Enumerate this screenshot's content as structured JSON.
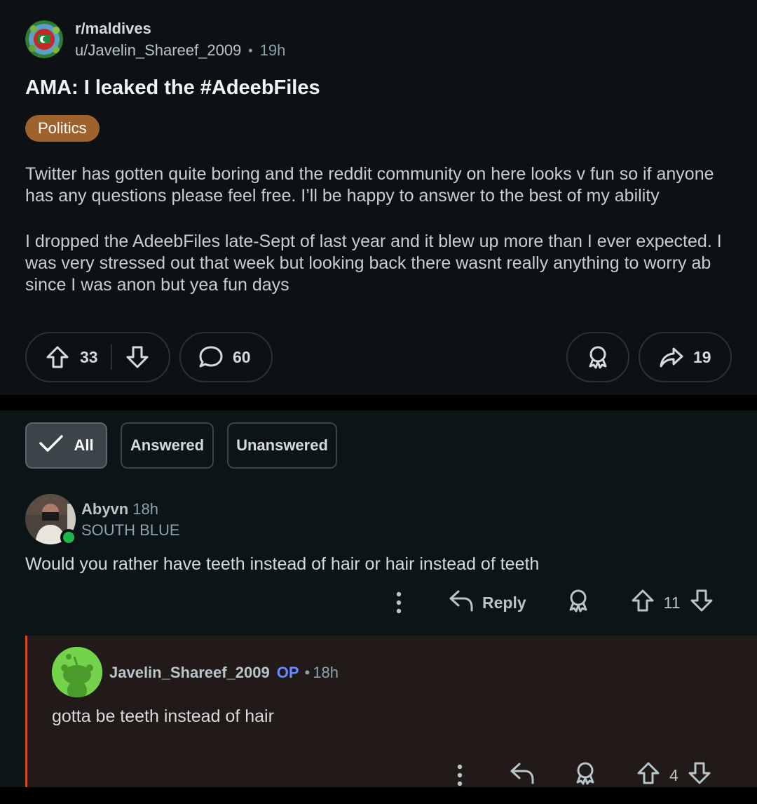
{
  "post": {
    "subreddit": "r/maldives",
    "author": "u/Javelin_Shareef_2009",
    "separator": "•",
    "age": "19h",
    "title": "AMA: I leaked the #AdeebFiles",
    "flair": "Politics",
    "flair_color": "#a0622d",
    "body": [
      "Twitter has gotten quite boring and the reddit community on here looks v fun so if anyone has any questions please feel free. I’ll be happy to answer to the best of my ability",
      "I dropped the AdeebFiles late-Sept of last year and it blew up more than I ever expected. I was very stressed out that week but looking back there wasnt really anything to worry ab since I was anon but yea fun days"
    ],
    "votes": "33",
    "comments": "60",
    "shares": "19"
  },
  "filters": {
    "all": "All",
    "answered": "Answered",
    "unanswered": "Unanswered",
    "active": "all"
  },
  "comments": [
    {
      "author": "Abyvn",
      "age": "18h",
      "user_flair": "SOUTH BLUE",
      "text": "Would you rather have teeth instead of hair or hair instead of teeth",
      "reply_label": "Reply",
      "votes": "11",
      "online": true
    },
    {
      "author": "Javelin_Shareef_2009",
      "badge": "OP",
      "separator": "•",
      "age": "18h",
      "text": "gotta be teeth instead of hair",
      "votes": "4",
      "thread_color": "#d24a1e"
    }
  ]
}
